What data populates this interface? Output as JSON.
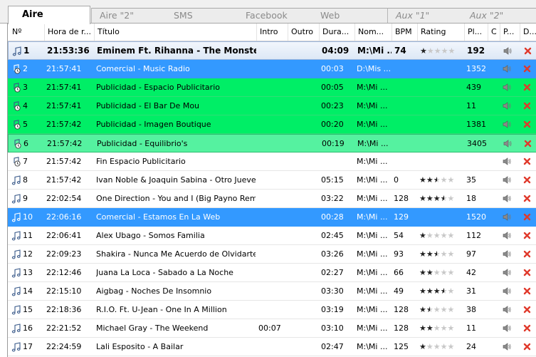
{
  "tabs": [
    {
      "label": "Aire",
      "active": true,
      "italic": false
    },
    {
      "label": "Aire \"2\"",
      "active": false,
      "italic": false
    },
    {
      "label": "SMS",
      "active": false,
      "italic": false
    },
    {
      "label": "Facebook",
      "active": false,
      "italic": false
    },
    {
      "label": "Web",
      "active": false,
      "italic": false
    },
    {
      "label": "Aux \"1\"",
      "active": false,
      "italic": true
    },
    {
      "label": "Aux \"2\"",
      "active": false,
      "italic": true
    }
  ],
  "columns": [
    "Nº",
    "Hora de r...",
    "Título",
    "Intro",
    "Outro",
    "Dura...",
    "Nom...",
    "BPM",
    "Rating",
    "Pl...",
    "C",
    "P...",
    "D..."
  ],
  "rows": [
    {
      "n": "1",
      "hora": "21:53:36",
      "titulo": "Eminem Ft. Rihanna - The Monster",
      "intro": "",
      "outro": "",
      "dur": "04:09",
      "nom": "M:\\Mi ...",
      "bpm": "74",
      "rating": 1,
      "pl": "192",
      "style": "playing",
      "icon": "note"
    },
    {
      "n": "2",
      "hora": "21:57:41",
      "titulo": "Comercial - Music Radio",
      "intro": "",
      "outro": "",
      "dur": "00:03",
      "nom": "D:\\Mis ...",
      "bpm": "",
      "rating": 0,
      "pl": "1352",
      "style": "blue",
      "icon": "clock"
    },
    {
      "n": "3",
      "hora": "21:57:41",
      "titulo": "Publicidad - Espacio Publicitario",
      "intro": "",
      "outro": "",
      "dur": "00:05",
      "nom": "M:\\Mi ...",
      "bpm": "",
      "rating": 0,
      "pl": "439",
      "style": "green",
      "icon": "clock"
    },
    {
      "n": "4",
      "hora": "21:57:41",
      "titulo": "Publicidad - El Bar De Mou",
      "intro": "",
      "outro": "",
      "dur": "00:23",
      "nom": "M:\\Mi ...",
      "bpm": "",
      "rating": 0,
      "pl": "11",
      "style": "green",
      "icon": "clock"
    },
    {
      "n": "5",
      "hora": "21:57:42",
      "titulo": "Publicidad - Imagen Boutique",
      "intro": "",
      "outro": "",
      "dur": "00:20",
      "nom": "M:\\Mi ...",
      "bpm": "",
      "rating": 0,
      "pl": "1381",
      "style": "green",
      "icon": "clock"
    },
    {
      "n": "6",
      "hora": "21:57:42",
      "titulo": "Publicidad - Equilibrio's",
      "intro": "",
      "outro": "",
      "dur": "00:19",
      "nom": "M:\\Mi ...",
      "bpm": "",
      "rating": 0,
      "pl": "3405",
      "style": "green2",
      "icon": "clock"
    },
    {
      "n": "7",
      "hora": "21:57:42",
      "titulo": "Fin Espacio Publicitario",
      "intro": "",
      "outro": "",
      "dur": "",
      "nom": "M:\\Mi ...",
      "bpm": "",
      "rating": 0,
      "pl": "",
      "style": "white",
      "icon": "clock"
    },
    {
      "n": "8",
      "hora": "21:57:42",
      "titulo": "Ivan Noble & Joaquin Sabina - Otro Jueves ...",
      "intro": "",
      "outro": "",
      "dur": "05:15",
      "nom": "M:\\Mi ...",
      "bpm": "0",
      "rating": 2.5,
      "pl": "35",
      "style": "white",
      "icon": "note"
    },
    {
      "n": "9",
      "hora": "22:02:54",
      "titulo": "One Direction - You and I (Big Payno Remix)",
      "intro": "",
      "outro": "",
      "dur": "03:22",
      "nom": "M:\\Mi ...",
      "bpm": "128",
      "rating": 3.5,
      "pl": "18",
      "style": "white",
      "icon": "note"
    },
    {
      "n": "10",
      "hora": "22:06:16",
      "titulo": "Comercial - Estamos En La Web",
      "intro": "",
      "outro": "",
      "dur": "00:28",
      "nom": "M:\\Mi ...",
      "bpm": "129",
      "rating": 0,
      "pl": "1520",
      "style": "blue",
      "icon": "note"
    },
    {
      "n": "11",
      "hora": "22:06:41",
      "titulo": "Alex Ubago - Somos Familia",
      "intro": "",
      "outro": "",
      "dur": "02:45",
      "nom": "M:\\Mi ...",
      "bpm": "54",
      "rating": 1,
      "pl": "112",
      "style": "white",
      "icon": "note"
    },
    {
      "n": "12",
      "hora": "22:09:23",
      "titulo": "Shakira - Nunca Me Acuerdo de Olvidarte",
      "intro": "",
      "outro": "",
      "dur": "03:26",
      "nom": "M:\\Mi ...",
      "bpm": "93",
      "rating": 2.5,
      "pl": "97",
      "style": "white",
      "icon": "note"
    },
    {
      "n": "13",
      "hora": "22:12:46",
      "titulo": "Juana La Loca - Sabado a La Noche",
      "intro": "",
      "outro": "",
      "dur": "02:27",
      "nom": "M:\\Mi ...",
      "bpm": "66",
      "rating": 2,
      "pl": "42",
      "style": "white",
      "icon": "note"
    },
    {
      "n": "14",
      "hora": "22:15:10",
      "titulo": "Aigbag - Noches De Insomnio",
      "intro": "",
      "outro": "",
      "dur": "03:30",
      "nom": "M:\\Mi ...",
      "bpm": "49",
      "rating": 3.5,
      "pl": "31",
      "style": "white",
      "icon": "note"
    },
    {
      "n": "15",
      "hora": "22:18:36",
      "titulo": "R.I.O. Ft. U-Jean - One In A Million",
      "intro": "",
      "outro": "",
      "dur": "03:19",
      "nom": "M:\\Mi ...",
      "bpm": "128",
      "rating": 1.5,
      "pl": "38",
      "style": "white",
      "icon": "note"
    },
    {
      "n": "16",
      "hora": "22:21:52",
      "titulo": "Michael Gray - The Weekend",
      "intro": "00:07",
      "outro": "",
      "dur": "03:10",
      "nom": "M:\\Mi ...",
      "bpm": "128",
      "rating": 2,
      "pl": "11",
      "style": "white",
      "icon": "note"
    },
    {
      "n": "17",
      "hora": "22:24:59",
      "titulo": "Lali Esposito - A Bailar",
      "intro": "",
      "outro": "",
      "dur": "02:47",
      "nom": "M:\\Mi ...",
      "bpm": "125",
      "rating": 1,
      "pl": "24",
      "style": "white",
      "icon": "note"
    }
  ],
  "icons": {
    "speaker": "speaker-icon",
    "delete": "delete-x-icon",
    "note": "music-note-icon",
    "clock": "scheduled-clock-icon"
  },
  "colors": {
    "playing_bg": "#dde8f6",
    "selected_blue": "#3399ff",
    "ad_green": "#00ee66",
    "ad_green_light": "#55f2a0",
    "delete_red": "#e0392b"
  }
}
